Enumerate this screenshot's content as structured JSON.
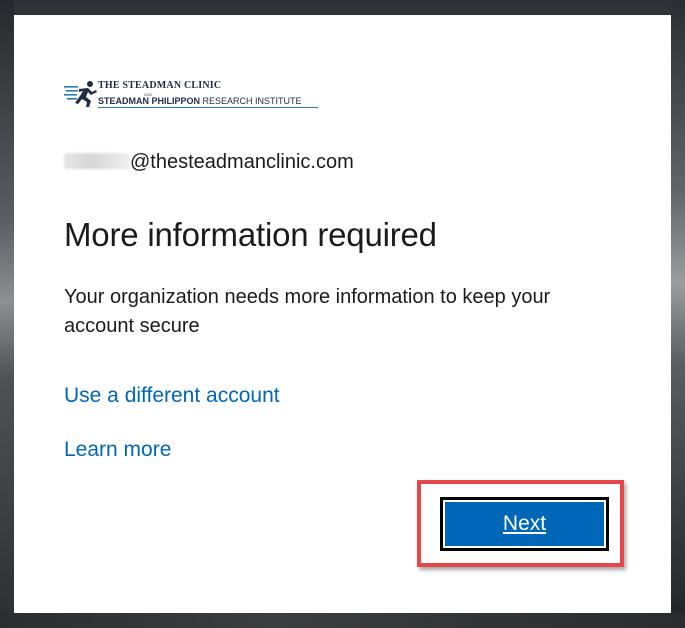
{
  "logo": {
    "line1": "THE STEADMAN CLINIC",
    "and": "AND",
    "line2_bold": "STEADMAN PHILIPPON",
    "line2_rest": " RESEARCH INSTITUTE"
  },
  "account": {
    "email_domain": "@thesteadmanclinic.com"
  },
  "heading": "More information required",
  "description": "Your organization needs more information to keep your account secure",
  "links": {
    "different_account": "Use a different account",
    "learn_more": "Learn more"
  },
  "next_button": "Next",
  "colors": {
    "link": "#0067b8",
    "button": "#0067b8",
    "highlight": "#e8474a"
  }
}
